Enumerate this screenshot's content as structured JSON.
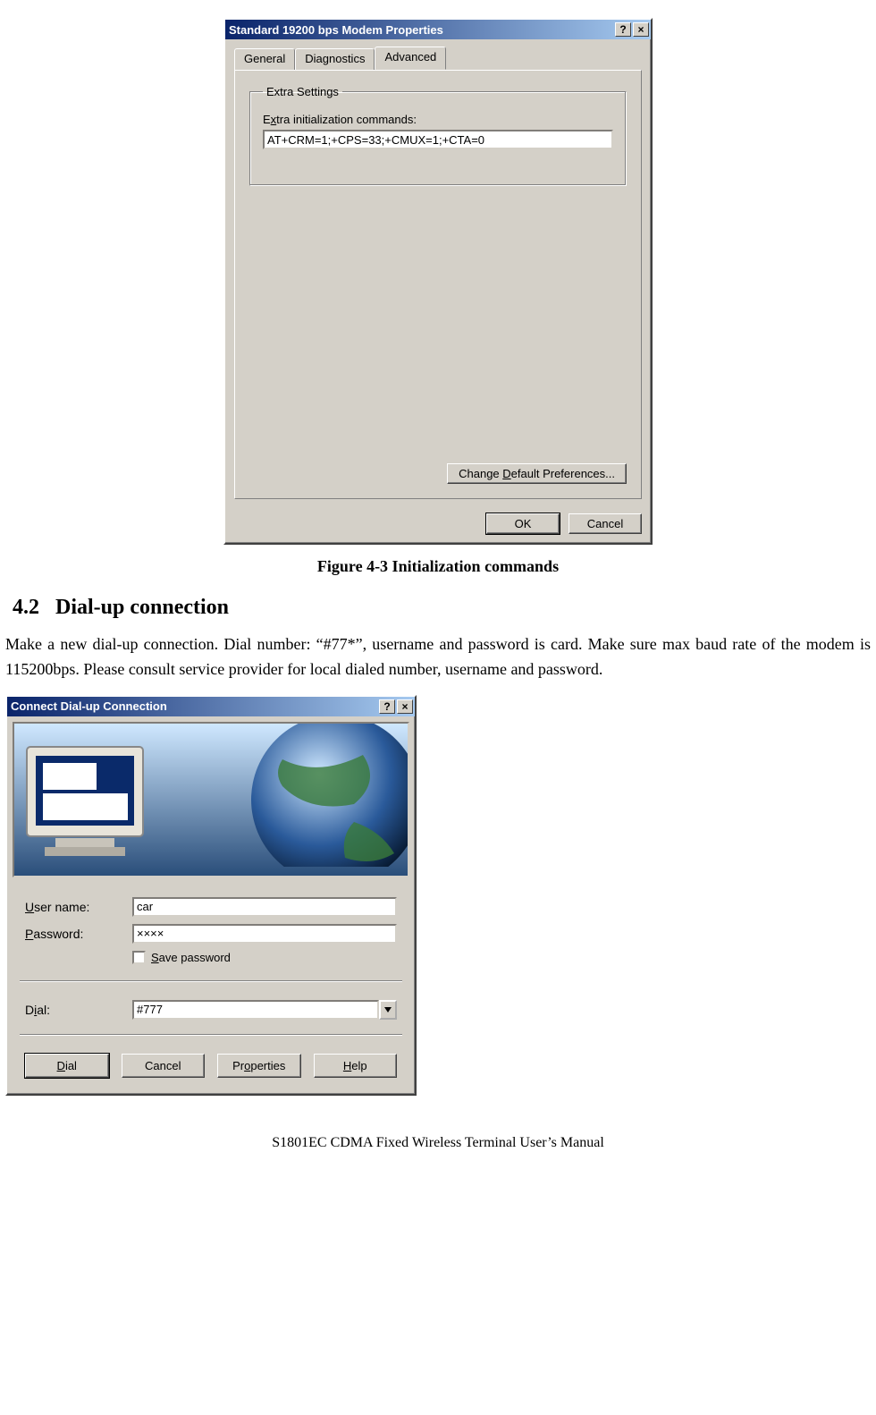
{
  "dialog1": {
    "title": "Standard 19200 bps Modem Properties",
    "help_glyph": "?",
    "close_glyph": "×",
    "tabs": {
      "general": "General",
      "diagnostics": "Diagnostics",
      "advanced": "Advanced"
    },
    "group_legend": "Extra Settings",
    "init_label_pre": "E",
    "init_label_u": "x",
    "init_label_post": "tra initialization commands:",
    "init_value": "AT+CRM=1;+CPS=33;+CMUX=1;+CTA=0",
    "change_btn_pre": "Change ",
    "change_btn_u": "D",
    "change_btn_post": "efault Preferences...",
    "ok": "OK",
    "cancel": "Cancel"
  },
  "figure_caption": "Figure 4-3 Initialization commands",
  "section_number": "4.2",
  "section_title": "Dial-up connection",
  "paragraph": "Make a new dial-up connection. Dial number: “#77*”, username and password is card. Make sure max baud rate of the modem is 115200bps. Please consult service provider for local dialed number, username and password.",
  "dialog2": {
    "title": "Connect Dial-up Connection",
    "help_glyph": "?",
    "close_glyph": "×",
    "user_label_u": "U",
    "user_label_post": "ser name:",
    "user_value": "car",
    "pass_label_u": "P",
    "pass_label_post": "assword:",
    "pass_value": "××××",
    "save_u": "S",
    "save_post": "ave password",
    "dial_label_pre": "D",
    "dial_label_u": "i",
    "dial_label_post": "al:",
    "dial_value": "#777",
    "btn_dial_u": "D",
    "btn_dial_post": "ial",
    "btn_cancel": "Cancel",
    "btn_props_pre": "Pr",
    "btn_props_u": "o",
    "btn_props_post": "perties",
    "btn_help_u": "H",
    "btn_help_post": "elp"
  },
  "footer": "S1801EC CDMA Fixed Wireless Terminal User’s Manual"
}
